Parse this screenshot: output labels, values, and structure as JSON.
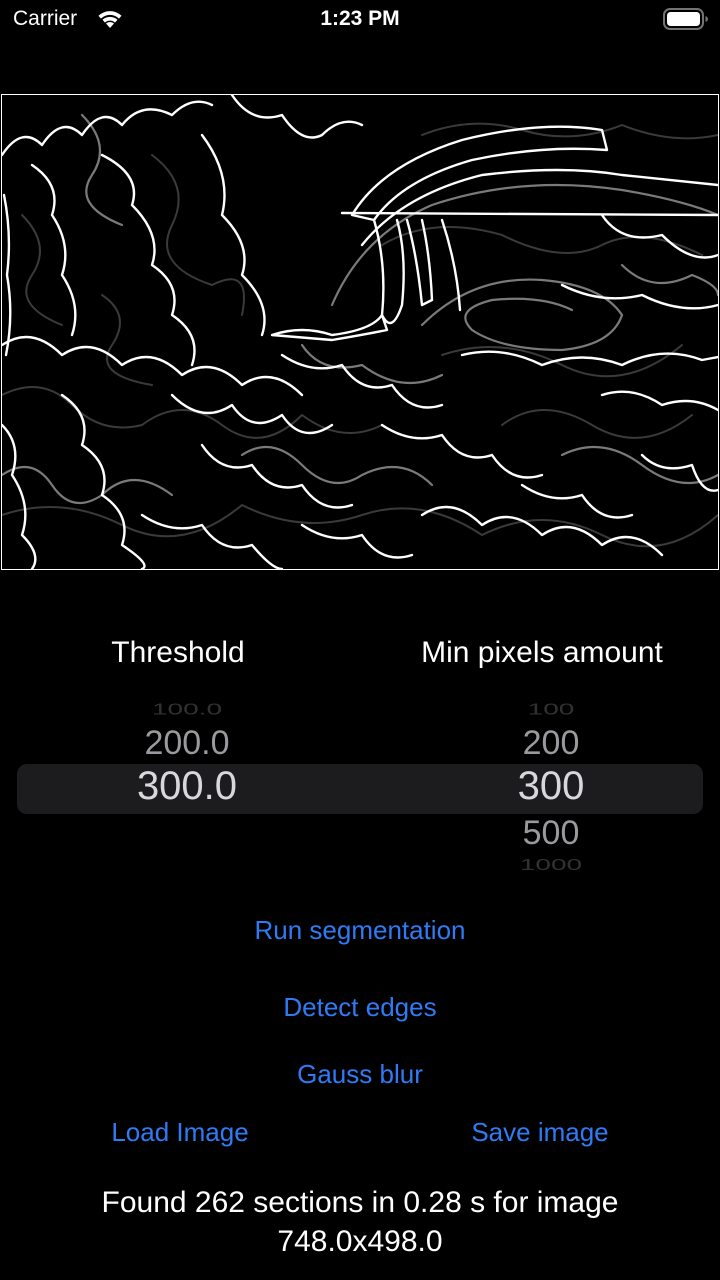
{
  "status_bar": {
    "carrier": "Carrier",
    "time": "1:23 PM",
    "wifi_icon": "wifi-icon",
    "battery_icon": "battery-icon"
  },
  "image_view": {
    "content": "edge-detection-output-image"
  },
  "pickers": {
    "threshold": {
      "title": "Threshold",
      "above_far": "100.0",
      "above": "200.0",
      "selected": "300.0",
      "below": "",
      "below_far": ""
    },
    "min_pixels": {
      "title": "Min pixels amount",
      "above_far": "100",
      "above": "200",
      "selected": "300",
      "below": "500",
      "below_far": "1000"
    }
  },
  "buttons": {
    "run_segmentation": "Run segmentation",
    "detect_edges": "Detect edges",
    "gauss_blur": "Gauss blur",
    "load_image": "Load Image",
    "save_image": "Save image"
  },
  "result_text": {
    "line1": "Found 262 sections in 0.28 s for image",
    "line2": "748.0x498.0"
  },
  "colors": {
    "accent": "#2f7bf5",
    "background": "#000000",
    "picker_highlight": "#1c1c1e"
  }
}
